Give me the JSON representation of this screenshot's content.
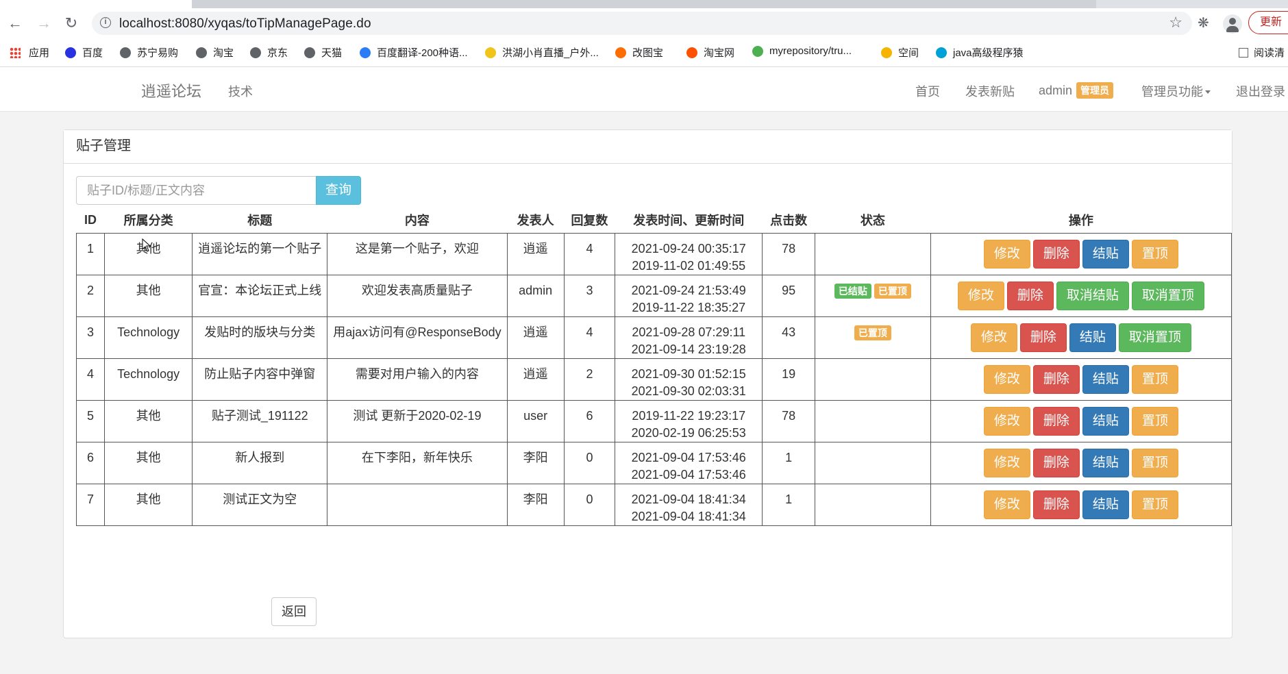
{
  "browser": {
    "url": "localhost:8080/xyqas/toTipManagePage.do",
    "update_label": "更新",
    "bookmarks": [
      {
        "label": "应用",
        "color": "#ea4335"
      },
      {
        "label": "百度",
        "color": "#2932e1"
      },
      {
        "label": "苏宁易购",
        "color": "#5f6368"
      },
      {
        "label": "淘宝",
        "color": "#5f6368"
      },
      {
        "label": "京东",
        "color": "#5f6368"
      },
      {
        "label": "天猫",
        "color": "#5f6368"
      },
      {
        "label": "百度翻译-200种语...",
        "color": "#2b7cf6"
      },
      {
        "label": "洪湖小肖直播_户外...",
        "color": "#f0c419"
      },
      {
        "label": "改图宝",
        "color": "#ff6d00"
      },
      {
        "label": "淘宝网",
        "color": "#ff5000"
      },
      {
        "label": "myrepository/tru...",
        "color": "#4caf50"
      },
      {
        "label": "空间",
        "color": "#f4b400"
      },
      {
        "label": "java高级程序猿",
        "color": "#00a1d6"
      }
    ],
    "reading_list_label": "阅读清"
  },
  "site": {
    "brand": "逍遥论坛",
    "category": "技术",
    "nav": {
      "home": "首页",
      "new_post": "发表新贴",
      "user": "admin",
      "role_badge": "管理员",
      "admin_menu": "管理员功能",
      "logout": "退出登录"
    }
  },
  "panel": {
    "title": "贴子管理",
    "search_placeholder": "贴子ID/标题/正文内容",
    "search_button": "查询",
    "back_button": "返回"
  },
  "table": {
    "headers": [
      "ID",
      "所属分类",
      "标题",
      "内容",
      "发表人",
      "回复数",
      "发表时间、更新时间",
      "点击数",
      "状态",
      "操作"
    ],
    "rows": [
      {
        "id": "1",
        "category": "其他",
        "title": "逍遥论坛的第一个贴子",
        "content": "这是第一个贴子，欢迎",
        "author": "逍遥",
        "replies": "4",
        "created": "2021-09-24 00:35:17",
        "updated": "2019-11-02 01:49:55",
        "clicks": "78",
        "status": [],
        "ops": [
          "修改",
          "删除",
          "结贴",
          "置顶"
        ]
      },
      {
        "id": "2",
        "category": "其他",
        "title": "官宣：本论坛正式上线",
        "content": "欢迎发表高质量贴子",
        "author": "admin",
        "replies": "3",
        "created": "2021-09-24 21:53:49",
        "updated": "2019-11-22 18:35:27",
        "clicks": "95",
        "status": [
          "已结贴",
          "已置顶"
        ],
        "ops": [
          "修改",
          "删除",
          "取消结贴",
          "取消置顶"
        ]
      },
      {
        "id": "3",
        "category": "Technology",
        "title": "发贴时的版块与分类",
        "content": "用ajax访问有@ResponseBody",
        "author": "逍遥",
        "replies": "4",
        "created": "2021-09-28 07:29:11",
        "updated": "2021-09-14 23:19:28",
        "clicks": "43",
        "status": [
          "已置顶"
        ],
        "ops": [
          "修改",
          "删除",
          "结贴",
          "取消置顶"
        ]
      },
      {
        "id": "4",
        "category": "Technology",
        "title": "防止贴子内容中弹窗",
        "content": "需要对用户输入的内容",
        "author": "逍遥",
        "replies": "2",
        "created": "2021-09-30 01:52:15",
        "updated": "2021-09-30 02:03:31",
        "clicks": "19",
        "status": [],
        "ops": [
          "修改",
          "删除",
          "结贴",
          "置顶"
        ]
      },
      {
        "id": "5",
        "category": "其他",
        "title": "贴子测试_191122",
        "content": "测试 更新于2020-02-19",
        "author": "user",
        "replies": "6",
        "created": "2019-11-22 19:23:17",
        "updated": "2020-02-19 06:25:53",
        "clicks": "78",
        "status": [],
        "ops": [
          "修改",
          "删除",
          "结贴",
          "置顶"
        ]
      },
      {
        "id": "6",
        "category": "其他",
        "title": "新人报到",
        "content": "在下李阳，新年快乐",
        "author": "李阳",
        "replies": "0",
        "created": "2021-09-04 17:53:46",
        "updated": "2021-09-04 17:53:46",
        "clicks": "1",
        "status": [],
        "ops": [
          "修改",
          "删除",
          "结贴",
          "置顶"
        ]
      },
      {
        "id": "7",
        "category": "其他",
        "title": "测试正文为空",
        "content": "",
        "author": "李阳",
        "replies": "0",
        "created": "2021-09-04 18:41:34",
        "updated": "2021-09-04 18:41:34",
        "clicks": "1",
        "status": [],
        "ops": [
          "修改",
          "删除",
          "结贴",
          "置顶"
        ]
      }
    ]
  },
  "colors": {
    "warning": "#f0ad4e",
    "danger": "#d9534f",
    "primary": "#337ab7",
    "success": "#5cb85c",
    "info": "#5bc0de"
  }
}
